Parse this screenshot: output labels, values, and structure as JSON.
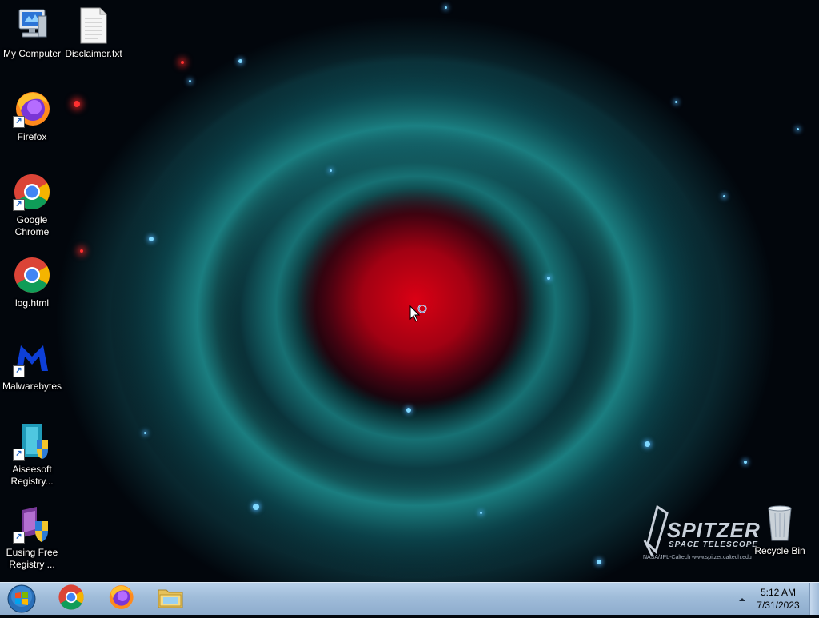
{
  "desktop": {
    "icons": [
      {
        "label": "My Computer",
        "icon": "computer-icon"
      },
      {
        "label": "Disclaimer.txt",
        "icon": "text-file-icon"
      },
      {
        "label": "Firefox",
        "icon": "firefox-icon"
      },
      {
        "label": "Google Chrome",
        "icon": "chrome-icon"
      },
      {
        "label": "log.html",
        "icon": "chrome-html-icon"
      },
      {
        "label": "Malwarebytes",
        "icon": "malwarebytes-icon"
      },
      {
        "label": "Aiseesoft Registry...",
        "icon": "aiseesoft-icon"
      },
      {
        "label": "Eusing Free Registry ...",
        "icon": "eusing-icon"
      },
      {
        "label": "Recycle Bin",
        "icon": "recycle-bin-icon"
      }
    ]
  },
  "wallpaper": {
    "logo_title": "SPITZER",
    "logo_subtitle": "SPACE TELESCOPE",
    "logo_credit": "NASA/JPL-Caltech        www.spitzer.caltech.edu"
  },
  "taskbar": {
    "pinned": [
      "chrome-icon",
      "firefox-icon",
      "file-explorer-icon"
    ],
    "time": "5:12 AM",
    "date": "7/31/2023"
  },
  "colors": {
    "taskbar": "#9fbcd9",
    "nebula_core": "#e00014",
    "nebula_ring": "#28c8c8"
  }
}
